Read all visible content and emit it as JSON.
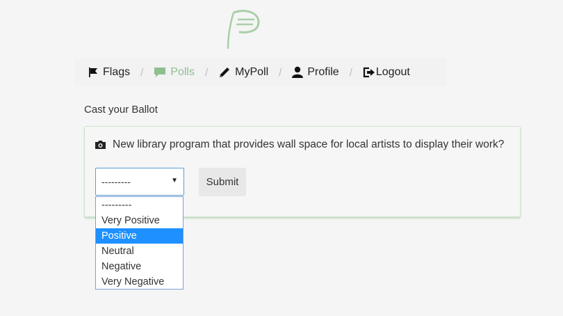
{
  "nav": {
    "items": [
      {
        "label": "Flags",
        "icon": "flag-icon"
      },
      {
        "label": "Polls",
        "icon": "comment-icon",
        "active": true
      },
      {
        "label": "MyPoll",
        "icon": "pencil-icon"
      },
      {
        "label": "Profile",
        "icon": "user-icon"
      },
      {
        "label": "Logout",
        "icon": "logout-icon"
      }
    ],
    "separator": "/"
  },
  "main": {
    "heading": "Cast your Ballot",
    "question": "New library program that provides wall space for local artists to display their work?",
    "question_icon": "camera-icon",
    "select_value": "---------",
    "submit_label": "Submit"
  },
  "dropdown": {
    "options": [
      "---------",
      "Very Positive",
      "Positive",
      "Neutral",
      "Negative",
      "Very Negative"
    ],
    "highlighted": "Positive"
  },
  "colors": {
    "accent": "#8fbf8f",
    "highlight": "#1e90ff",
    "select_border": "#5b9bd5"
  }
}
